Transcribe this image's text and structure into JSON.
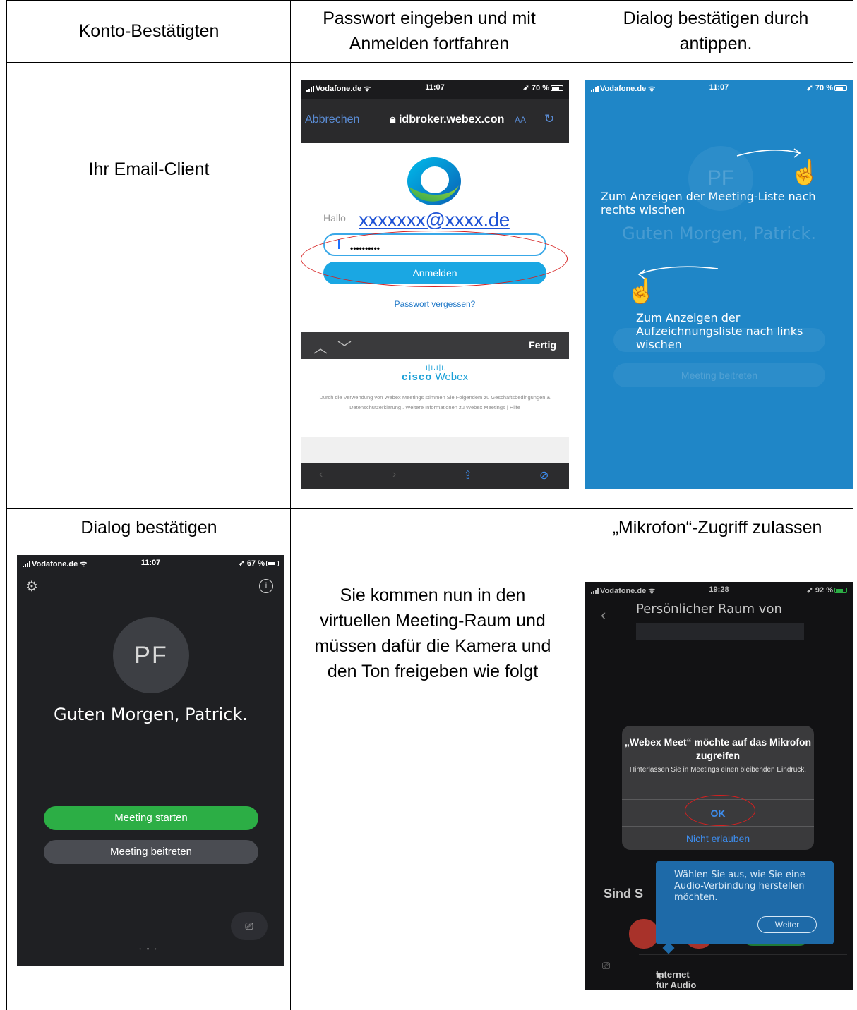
{
  "headers": {
    "col1": "Konto-Bestätigten",
    "col2": "Passwort eingeben und mit Anmelden fortfahren",
    "col3": "Dialog bestätigen durch antippen."
  },
  "row1": {
    "email_client": "Ihr Email-Client"
  },
  "row2": {
    "col1_title": "Dialog bestätigen",
    "col2_text": "Sie kommen nun in den virtuellen Meeting-Raum und müssen dafür die Kamera und den Ton freigeben wie folgt",
    "col3_title": "„Mikrofon“-Zugriff zulassen"
  },
  "phone_login": {
    "carrier": "Vodafone.de",
    "time": "11:07",
    "battery": "70 %",
    "cancel": "Abbrechen",
    "url": "idbroker.webex.con",
    "aa": "AA",
    "hallo": "Hallo",
    "email": "xxxxxxx@xxxx.de",
    "password": "••••••••••",
    "login_button": "Anmelden",
    "forgot": "Passwort vergessen?",
    "done": "Fertig",
    "brand": "cisco",
    "brand_product": "Webex",
    "legal": "Durch die Verwendung von Webex Meetings stimmen Sie Folgendem zu Geschäftsbedingungen & Datenschutzerklärung . Weitere Informationen zu Webex Meetings | Hilfe"
  },
  "phone_swipe": {
    "carrier": "Vodafone.de",
    "time": "11:07",
    "battery": "70 %",
    "hint_right": "Zum Anzeigen der Meeting-Liste nach rechts wischen",
    "hint_left": "Zum Anzeigen der Aufzeichnungsliste nach links wischen",
    "bg_greeting": "Guten Morgen, Patrick.",
    "bg_initials": "PF",
    "bg_button": "Meeting beitreten"
  },
  "phone_home": {
    "carrier": "Vodafone.de",
    "time": "11:07",
    "battery": "67 %",
    "initials": "PF",
    "greeting": "Guten Morgen, Patrick.",
    "start_button": "Meeting starten",
    "join_button": "Meeting beitreten"
  },
  "phone_mic": {
    "carrier": "Vodafone.de",
    "time": "19:28",
    "battery": "92 %",
    "room_title": "Persönlicher Raum von",
    "alert_title": "„Webex Meet“ möchte auf das Mikrofon zugreifen",
    "alert_message": "Hinterlassen Sie in Meetings einen bleibenden Eindruck.",
    "ok": "OK",
    "deny": "Nicht erlauben",
    "sind": "Sind S",
    "tooltip": "Wählen Sie aus, wie Sie eine Audio-Verbindung herstellen möchten.",
    "tooltip_button": "Weiter",
    "audio_option": "Internet für Audio verwenden"
  },
  "colors": {
    "login_blue": "#1aa7e3",
    "swipe_bg": "#1f86c7",
    "start_green": "#2cae45",
    "annotation_red": "#d62020"
  }
}
